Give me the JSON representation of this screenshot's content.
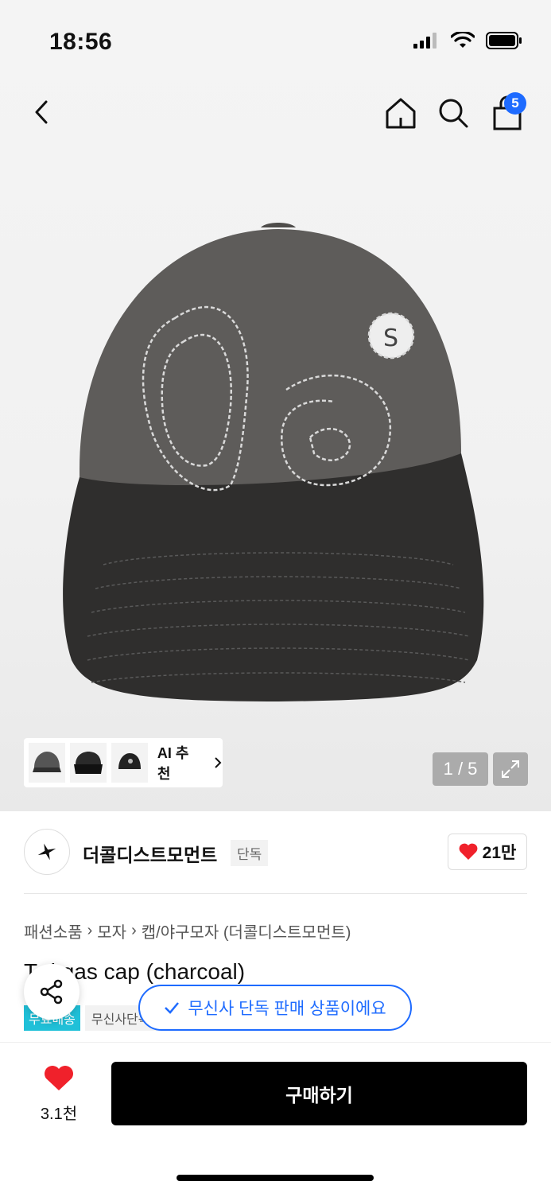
{
  "status_bar": {
    "time": "18:56"
  },
  "nav": {
    "cart_count": "5"
  },
  "gallery": {
    "ai_recommend": "AI 추천",
    "counter": "1 / 5"
  },
  "brand": {
    "name": "더콜디스트모먼트",
    "tag": "단독",
    "like_count": "21만"
  },
  "breadcrumb": [
    "패션소품",
    "모자",
    "캡/야구모자 (더콜디스트모먼트)"
  ],
  "product": {
    "title": "T  d qas cap (charcoal)",
    "badge_free": "무료배송",
    "badge_store": "무신사단독"
  },
  "toast": {
    "text": "무신사 단독 판매 상품이에요"
  },
  "bottom": {
    "wish_count": "3.1천",
    "buy_label": "구매하기"
  },
  "colors": {
    "accent": "#1e6bff",
    "like": "#f0212b",
    "free_badge": "#20c0d8"
  }
}
